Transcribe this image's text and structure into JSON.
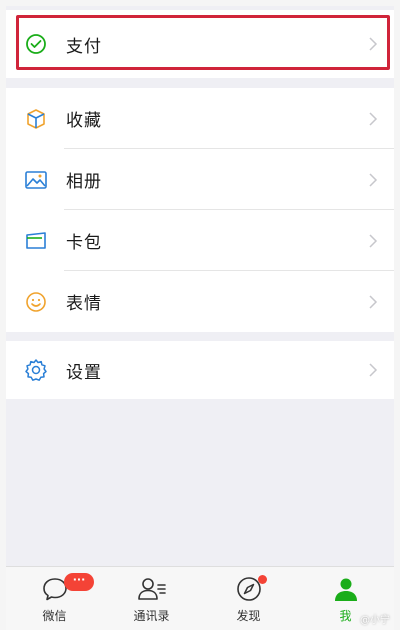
{
  "menu": {
    "pay": {
      "label": "支付",
      "icon": "wechat-pay-icon"
    },
    "favorites": {
      "label": "收藏",
      "icon": "cube-icon"
    },
    "album": {
      "label": "相册",
      "icon": "picture-icon"
    },
    "cards": {
      "label": "卡包",
      "icon": "card-wallet-icon"
    },
    "stickers": {
      "label": "表情",
      "icon": "smiley-icon"
    },
    "settings": {
      "label": "设置",
      "icon": "gear-icon"
    }
  },
  "tabbar": {
    "chats": {
      "label": "微信",
      "badge": "···",
      "icon": "chat-bubble-icon"
    },
    "contacts": {
      "label": "通讯录",
      "icon": "contacts-icon"
    },
    "discover": {
      "label": "发现",
      "icon": "compass-icon"
    },
    "me": {
      "label": "我",
      "icon": "person-icon",
      "active": true
    }
  },
  "colors": {
    "accent_green": "#1aad19",
    "highlight_red": "#d0243a",
    "badge_red": "#f44336"
  },
  "watermark": "@小宁"
}
